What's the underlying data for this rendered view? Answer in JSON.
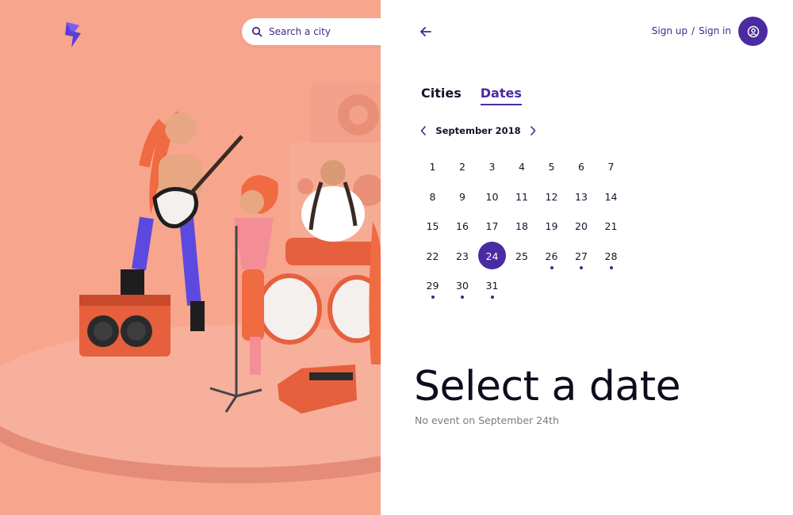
{
  "search": {
    "placeholder": "Search a city"
  },
  "header": {
    "sign_up": "Sign up",
    "separator": "/",
    "sign_in": "Sign in"
  },
  "tabs": [
    {
      "label": "Cities",
      "active": false
    },
    {
      "label": "Dates",
      "active": true
    }
  ],
  "calendar": {
    "month_label": "September 2018",
    "selected_day": 24,
    "days": [
      {
        "d": "1",
        "dot": false
      },
      {
        "d": "2",
        "dot": false
      },
      {
        "d": "3",
        "dot": false
      },
      {
        "d": "4",
        "dot": false
      },
      {
        "d": "5",
        "dot": false
      },
      {
        "d": "6",
        "dot": false
      },
      {
        "d": "7",
        "dot": false
      },
      {
        "d": "8",
        "dot": false
      },
      {
        "d": "9",
        "dot": false
      },
      {
        "d": "10",
        "dot": false
      },
      {
        "d": "11",
        "dot": false
      },
      {
        "d": "12",
        "dot": false
      },
      {
        "d": "13",
        "dot": false
      },
      {
        "d": "14",
        "dot": false
      },
      {
        "d": "15",
        "dot": false
      },
      {
        "d": "16",
        "dot": false
      },
      {
        "d": "17",
        "dot": false
      },
      {
        "d": "18",
        "dot": false
      },
      {
        "d": "19",
        "dot": false
      },
      {
        "d": "20",
        "dot": false
      },
      {
        "d": "21",
        "dot": false
      },
      {
        "d": "22",
        "dot": false
      },
      {
        "d": "23",
        "dot": false
      },
      {
        "d": "24",
        "dot": false
      },
      {
        "d": "25",
        "dot": false
      },
      {
        "d": "26",
        "dot": true
      },
      {
        "d": "27",
        "dot": true
      },
      {
        "d": "28",
        "dot": true
      },
      {
        "d": "29",
        "dot": true
      },
      {
        "d": "30",
        "dot": true
      },
      {
        "d": "31",
        "dot": true
      }
    ]
  },
  "main": {
    "heading": "Select a date",
    "subtext": "No event on September 24th"
  },
  "icons": {
    "logo": "lightning-bolt-icon",
    "search": "search-icon",
    "back": "arrow-left-icon",
    "prev": "chevron-left-icon",
    "next": "chevron-right-icon",
    "avatar": "user-icon"
  },
  "colors": {
    "accent": "#4a2ba0",
    "hero_bg": "#f8a58e",
    "text_dark": "#15132a",
    "muted": "#7b7b85"
  }
}
